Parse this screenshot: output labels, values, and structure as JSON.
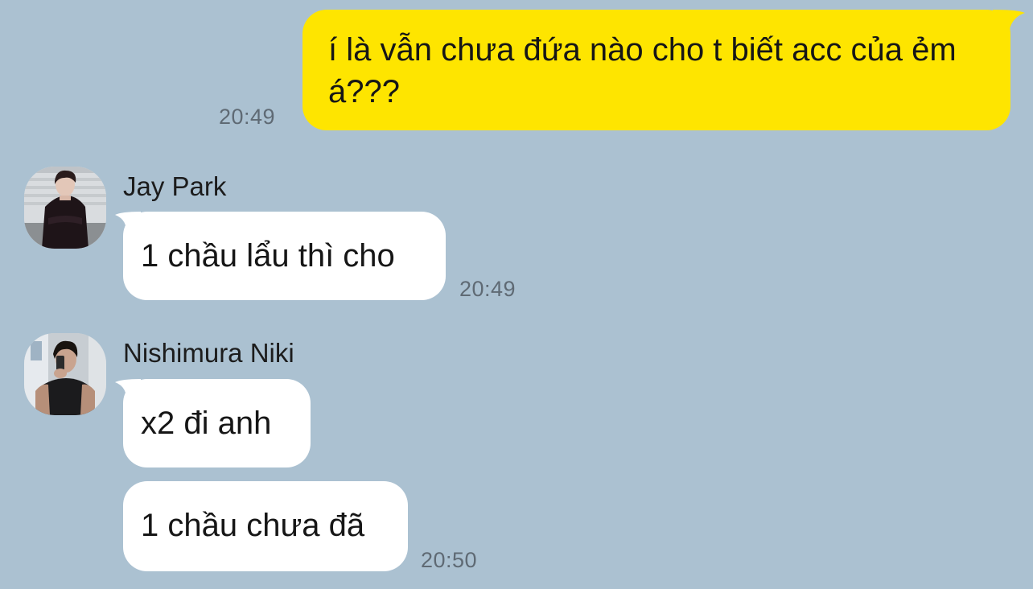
{
  "colors": {
    "background": "#abc1d1",
    "outgoing_bubble": "#fee500",
    "incoming_bubble": "#ffffff"
  },
  "outgoing": {
    "text": "í là vẫn chưa đứa nào cho t biết acc của ẻm á???",
    "time": "20:49"
  },
  "groups": [
    {
      "sender": "Jay Park",
      "avatar_icon": "profile-photo-icon",
      "messages": [
        {
          "text": "1 chầu lẩu thì cho"
        }
      ],
      "time": "20:49"
    },
    {
      "sender": "Nishimura Niki",
      "avatar_icon": "profile-photo-icon",
      "messages": [
        {
          "text": "x2 đi anh"
        },
        {
          "text": "1 chầu chưa đã"
        }
      ],
      "time": "20:50"
    }
  ]
}
